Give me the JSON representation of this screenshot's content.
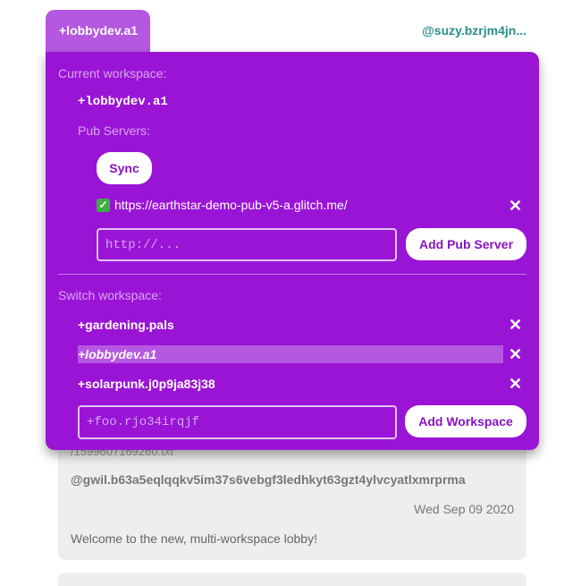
{
  "header": {
    "tab_label": "+lobbydev.a1",
    "user_id": "@suzy.bzrjm4jn..."
  },
  "panel": {
    "current_workspace_label": "Current workspace:",
    "current_workspace": "+lobbydev.a1",
    "pub_servers_label": "Pub Servers:",
    "sync_label": "Sync",
    "pub_servers": [
      {
        "url": "https://earthstar-demo-pub-v5-a.glitch.me/",
        "status_icon": "check-mark-icon",
        "status_color": "#3cb043"
      }
    ],
    "pub_input_placeholder": "http://...",
    "add_pub_label": "Add Pub Server",
    "switch_workspace_label": "Switch workspace:",
    "workspaces": [
      {
        "name": "+gardening.pals",
        "current": false
      },
      {
        "name": "+lobbydev.a1",
        "current": true
      },
      {
        "name": "+solarpunk.j0p9ja83j38",
        "current": false
      }
    ],
    "workspace_input_placeholder": "+foo.rjo34irqjf",
    "add_workspace_label": "Add Workspace",
    "remove_symbol": "✕"
  },
  "feed": {
    "post": {
      "path": "/1599607169260.txt",
      "author": "@gwil.b63a5eqlqqkv5im37s6vebgf3ledhkyt63gzt4ylvcyatlxmrprma",
      "date": "Wed Sep 09 2020",
      "body": "Welcome to the new, multi-workspace lobby!"
    }
  },
  "colors": {
    "panel": "#9a14d6",
    "tab": "#b557e0",
    "accent_text": "#2a8f8a"
  }
}
